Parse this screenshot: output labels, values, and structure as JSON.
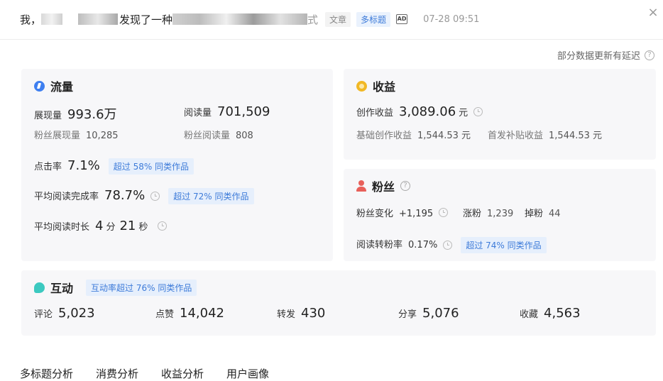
{
  "header": {
    "title_start": "我，",
    "title_mid": "发现了一种",
    "title_end": "式",
    "tag_article": "文章",
    "tag_multi_title": "多标题",
    "ad_label": "AD",
    "time": "07-28 09:51",
    "close": "×"
  },
  "notice": {
    "text": "部分数据更新有延迟",
    "help": "?"
  },
  "traffic": {
    "title": "流量",
    "impressions_label": "展现量",
    "impressions_value": "993.6万",
    "reads_label": "阅读量",
    "reads_value": "701,509",
    "fan_impressions_label": "粉丝展现量",
    "fan_impressions_value": "10,285",
    "fan_reads_label": "粉丝阅读量",
    "fan_reads_value": "808",
    "ctr_label": "点击率",
    "ctr_value": "7.1%",
    "ctr_badge": "超过 58% 同类作品",
    "completion_label": "平均阅读完成率",
    "completion_value": "78.7%",
    "completion_badge": "超过 72% 同类作品",
    "duration_label": "平均阅读时长",
    "duration_min": "4",
    "duration_min_unit": "分",
    "duration_sec": "21",
    "duration_sec_unit": "秒"
  },
  "revenue": {
    "title": "收益",
    "creation_label": "创作收益",
    "creation_value": "3,089.06",
    "creation_unit": "元",
    "basic_label": "基础创作收益",
    "basic_value": "1,544.53 元",
    "first_label": "首发补贴收益",
    "first_value": "1,544.53 元"
  },
  "fans": {
    "title": "粉丝",
    "help": "?",
    "change_label": "粉丝变化",
    "change_value": "+1,195",
    "gain_label": "涨粉",
    "gain_value": "1,239",
    "loss_label": "掉粉",
    "loss_value": "44",
    "conversion_label": "阅读转粉率",
    "conversion_value": "0.17%",
    "conversion_badge": "超过 74% 同类作品"
  },
  "interaction": {
    "title": "互动",
    "badge": "互动率超过 76% 同类作品",
    "items": [
      {
        "label": "评论",
        "value": "5,023"
      },
      {
        "label": "点赞",
        "value": "14,042"
      },
      {
        "label": "转发",
        "value": "430"
      },
      {
        "label": "分享",
        "value": "5,076"
      },
      {
        "label": "收藏",
        "value": "4,563"
      }
    ]
  },
  "tabs": [
    "多标题分析",
    "消费分析",
    "收益分析",
    "用户画像"
  ]
}
